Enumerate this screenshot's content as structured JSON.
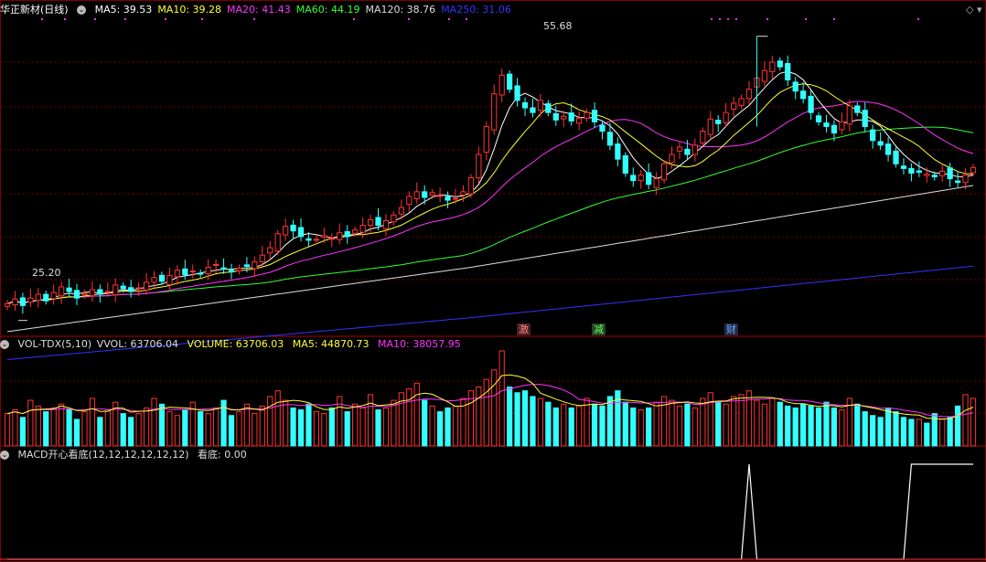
{
  "header": {
    "title": "华正新材(日线)",
    "ma": [
      {
        "label": "MA5: 39.53",
        "color": "#ffffff"
      },
      {
        "label": "MA10: 39.28",
        "color": "#ffff33"
      },
      {
        "label": "MA20: 41.43",
        "color": "#ff33ff"
      },
      {
        "label": "MA60: 44.19",
        "color": "#33ff33"
      },
      {
        "label": "MA120: 38.76",
        "color": "#dddddd"
      },
      {
        "label": "MA250: 31.06",
        "color": "#3333ff"
      }
    ]
  },
  "price_labels": {
    "high": "55.68",
    "low": "25.20"
  },
  "event_tags": [
    {
      "text": "激",
      "color": "#ff8080"
    },
    {
      "text": "减",
      "color": "#66ff66"
    },
    {
      "text": "财",
      "color": "#66aaff"
    }
  ],
  "volume_header": {
    "name": "VOL-TDX(5,10)",
    "vvol": "VVOL: 63706.04",
    "volume": "VOLUME: 63706.03",
    "ma5": "MA5: 44870.73",
    "ma10": "MA10: 38057.95"
  },
  "macd_header": {
    "name": "MACD开心看底(12,12,12,12,12,12)",
    "value": "看底: 0.00"
  },
  "colors": {
    "up": "#ff3333",
    "down": "#33ffff",
    "ma5": "#ffffff",
    "ma10": "#ffff33",
    "ma20": "#ff33ff",
    "ma60": "#33ff33",
    "ma120": "#dddddd",
    "ma250": "#3333ff",
    "grid": "#7a0000"
  },
  "chart_data": {
    "type": "candlestick",
    "price_range": [
      23.5,
      58.0
    ],
    "high_marker": 55.68,
    "low_marker": 25.2,
    "closes": [
      27.0,
      27.5,
      26.8,
      27.6,
      28.0,
      27.3,
      28.2,
      28.8,
      28.3,
      27.6,
      28.1,
      28.5,
      28.0,
      28.3,
      29.0,
      28.6,
      28.3,
      28.7,
      29.3,
      29.8,
      29.4,
      30.0,
      30.6,
      30.1,
      30.5,
      30.2,
      30.9,
      31.2,
      30.7,
      30.4,
      30.8,
      31.0,
      31.5,
      32.2,
      33.0,
      34.5,
      35.3,
      34.8,
      34.2,
      33.8,
      33.9,
      34.3,
      34.0,
      34.6,
      34.2,
      34.9,
      35.4,
      36.0,
      35.4,
      35.9,
      36.5,
      37.3,
      38.5,
      39.0,
      38.4,
      38.9,
      38.6,
      38.1,
      38.3,
      39.0,
      40.5,
      43.0,
      46.0,
      49.5,
      51.5,
      50.0,
      48.8,
      48.0,
      47.5,
      48.8,
      47.5,
      46.7,
      47.1,
      46.6,
      46.9,
      47.5,
      46.5,
      45.5,
      44.0,
      42.5,
      41.0,
      40.2,
      40.8,
      39.8,
      40.4,
      42.0,
      43.0,
      43.8,
      43.0,
      44.0,
      45.5,
      46.8,
      46.3,
      47.5,
      48.5,
      49.0,
      50.0,
      51.2,
      52.0,
      52.9,
      52.4,
      51.0,
      49.8,
      49.0,
      47.5,
      46.5,
      46.0,
      45.3,
      46.5,
      48.2,
      47.5,
      46.0,
      44.5,
      44.0,
      43.0,
      42.0,
      41.5,
      41.0,
      41.1,
      40.9,
      40.6,
      41.2,
      40.4,
      40.0,
      40.8,
      41.6
    ],
    "volumes": [
      34,
      38,
      30,
      48,
      42,
      36,
      40,
      44,
      38,
      28,
      36,
      50,
      30,
      38,
      46,
      34,
      30,
      34,
      40,
      50,
      44,
      36,
      32,
      38,
      46,
      36,
      34,
      40,
      48,
      32,
      36,
      44,
      34,
      42,
      52,
      58,
      48,
      40,
      38,
      44,
      36,
      34,
      40,
      52,
      36,
      44,
      40,
      54,
      38,
      40,
      48,
      56,
      60,
      66,
      48,
      42,
      36,
      40,
      42,
      50,
      58,
      62,
      70,
      80,
      100,
      62,
      56,
      58,
      52,
      50,
      46,
      40,
      44,
      40,
      42,
      50,
      44,
      42,
      52,
      58,
      46,
      40,
      38,
      40,
      46,
      52,
      48,
      42,
      44,
      40,
      50,
      56,
      46,
      44,
      52,
      54,
      58,
      48,
      44,
      50,
      46,
      42,
      40,
      44,
      42,
      40,
      46,
      40,
      38,
      50,
      44,
      36,
      32,
      30,
      40,
      36,
      30,
      28,
      28,
      24,
      34,
      28,
      30,
      42,
      54,
      50
    ],
    "macd_signal_bars": [
      96,
      117,
      118,
      119,
      120,
      121,
      122,
      123,
      124,
      125
    ],
    "series": [
      "MA5",
      "MA10",
      "MA20",
      "MA60",
      "MA120",
      "MA250"
    ]
  }
}
